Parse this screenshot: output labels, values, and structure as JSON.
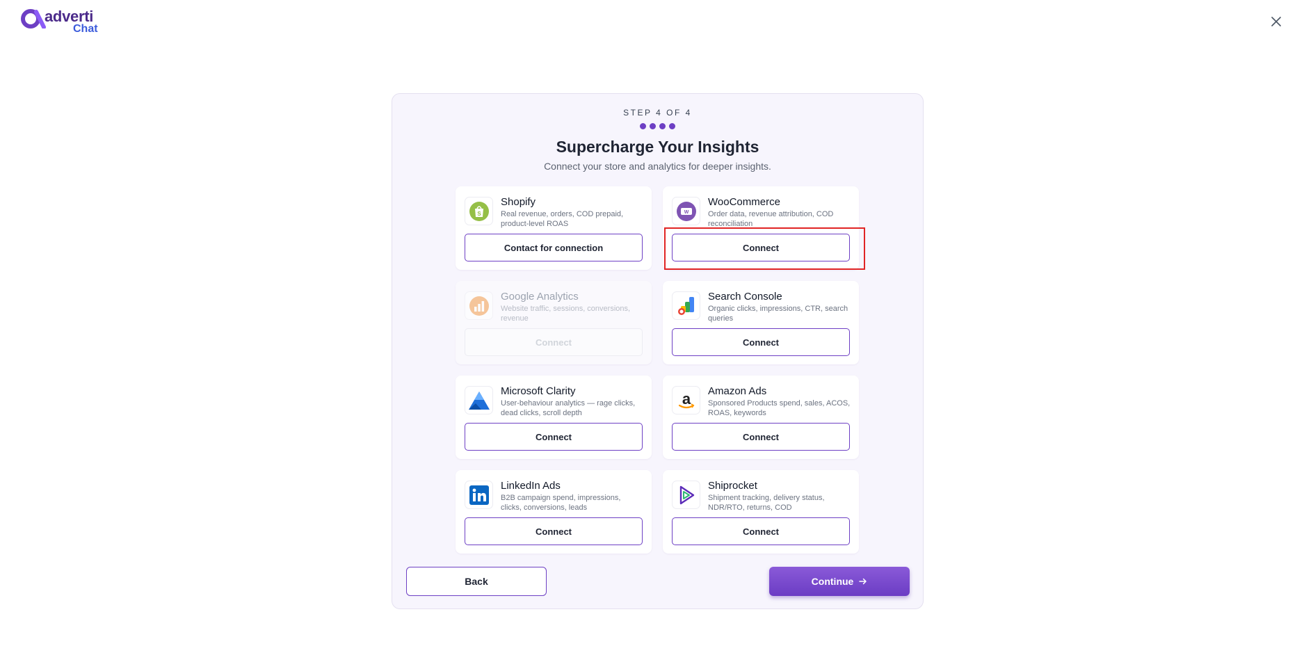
{
  "brand": {
    "logo_main": "adverti",
    "logo_sub": "Chat",
    "accent": "#6d3fc4"
  },
  "header": {
    "close_icon": "close-icon"
  },
  "wizard": {
    "step_label": "STEP 4 OF 4",
    "steps_total": 4,
    "title": "Supercharge Your Insights",
    "subtitle": "Connect your store and analytics for deeper insights."
  },
  "integrations": [
    {
      "name": "Shopify",
      "desc": "Real revenue, orders, COD prepaid, product-level ROAS",
      "button": "Contact for connection",
      "icon": "shopify-icon",
      "enabled": true
    },
    {
      "name": "WooCommerce",
      "desc": "Order data, revenue attribution, COD reconciliation",
      "button": "Connect",
      "icon": "woocommerce-icon",
      "enabled": true
    },
    {
      "name": "Google Analytics",
      "desc": "Website traffic, sessions, conversions, revenue",
      "button": "Connect",
      "icon": "google-analytics-icon",
      "enabled": false
    },
    {
      "name": "Search Console",
      "desc": "Organic clicks, impressions, CTR, search queries",
      "button": "Connect",
      "icon": "search-console-icon",
      "enabled": true
    },
    {
      "name": "Microsoft Clarity",
      "desc": "User-behaviour analytics — rage clicks, dead clicks, scroll depth",
      "button": "Connect",
      "icon": "microsoft-clarity-icon",
      "enabled": true
    },
    {
      "name": "Amazon Ads",
      "desc": "Sponsored Products spend, sales, ACOS, ROAS, keywords",
      "button": "Connect",
      "icon": "amazon-icon",
      "enabled": true
    },
    {
      "name": "LinkedIn Ads",
      "desc": "B2B campaign spend, impressions, clicks, conversions, leads",
      "button": "Connect",
      "icon": "linkedin-icon",
      "enabled": true
    },
    {
      "name": "Shiprocket",
      "desc": "Shipment tracking, delivery status, NDR/RTO, returns, COD",
      "button": "Connect",
      "icon": "shiprocket-icon",
      "enabled": true
    }
  ],
  "footer": {
    "back_label": "Back",
    "continue_label": "Continue",
    "continue_icon": "arrow-right-icon"
  }
}
